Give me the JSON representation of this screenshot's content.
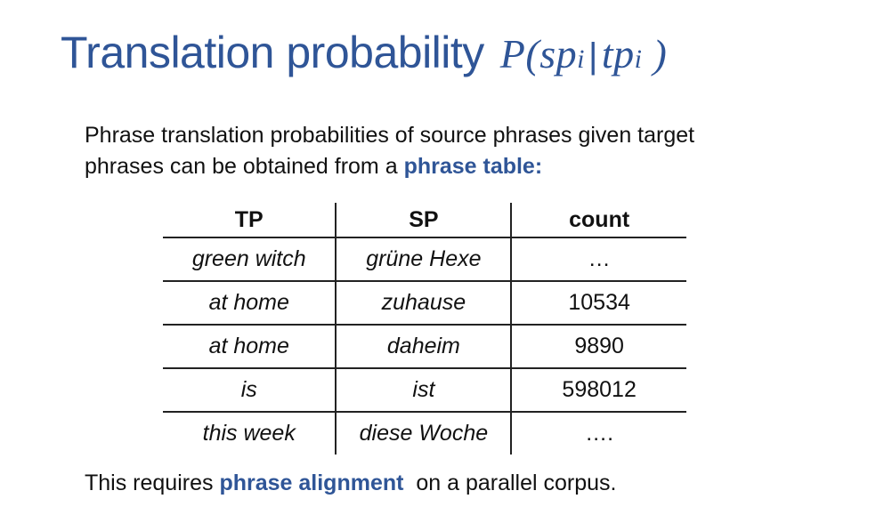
{
  "title": {
    "text": "Translation probability",
    "math_open": "P(",
    "math_sp": "sp",
    "math_sub1": "i",
    "math_bar": "|",
    "math_tp": "tp",
    "math_sub2": "i",
    "math_close": " )"
  },
  "intro": {
    "line1": "Phrase translation probabilities of source phrases given target",
    "line2_prefix": "phrases can be obtained from a ",
    "line2_highlight": "phrase table:"
  },
  "table": {
    "headers": [
      "TP",
      "SP",
      "count"
    ],
    "rows": [
      {
        "tp": "green witch",
        "sp": "grüne Hexe",
        "count": "…"
      },
      {
        "tp": "at home",
        "sp": "zuhause",
        "count": "10534"
      },
      {
        "tp": "at home",
        "sp": "daheim",
        "count": "9890"
      },
      {
        "tp": "is",
        "sp": "ist",
        "count": "598012"
      },
      {
        "tp": "this week",
        "sp": "diese Woche",
        "count": "…."
      }
    ]
  },
  "footer": {
    "prefix": "This requires ",
    "highlight": "phrase alignment",
    "suffix": "  on a parallel corpus."
  },
  "colors": {
    "accent": "#2f5597",
    "text": "#111111",
    "background": "#ffffff"
  }
}
